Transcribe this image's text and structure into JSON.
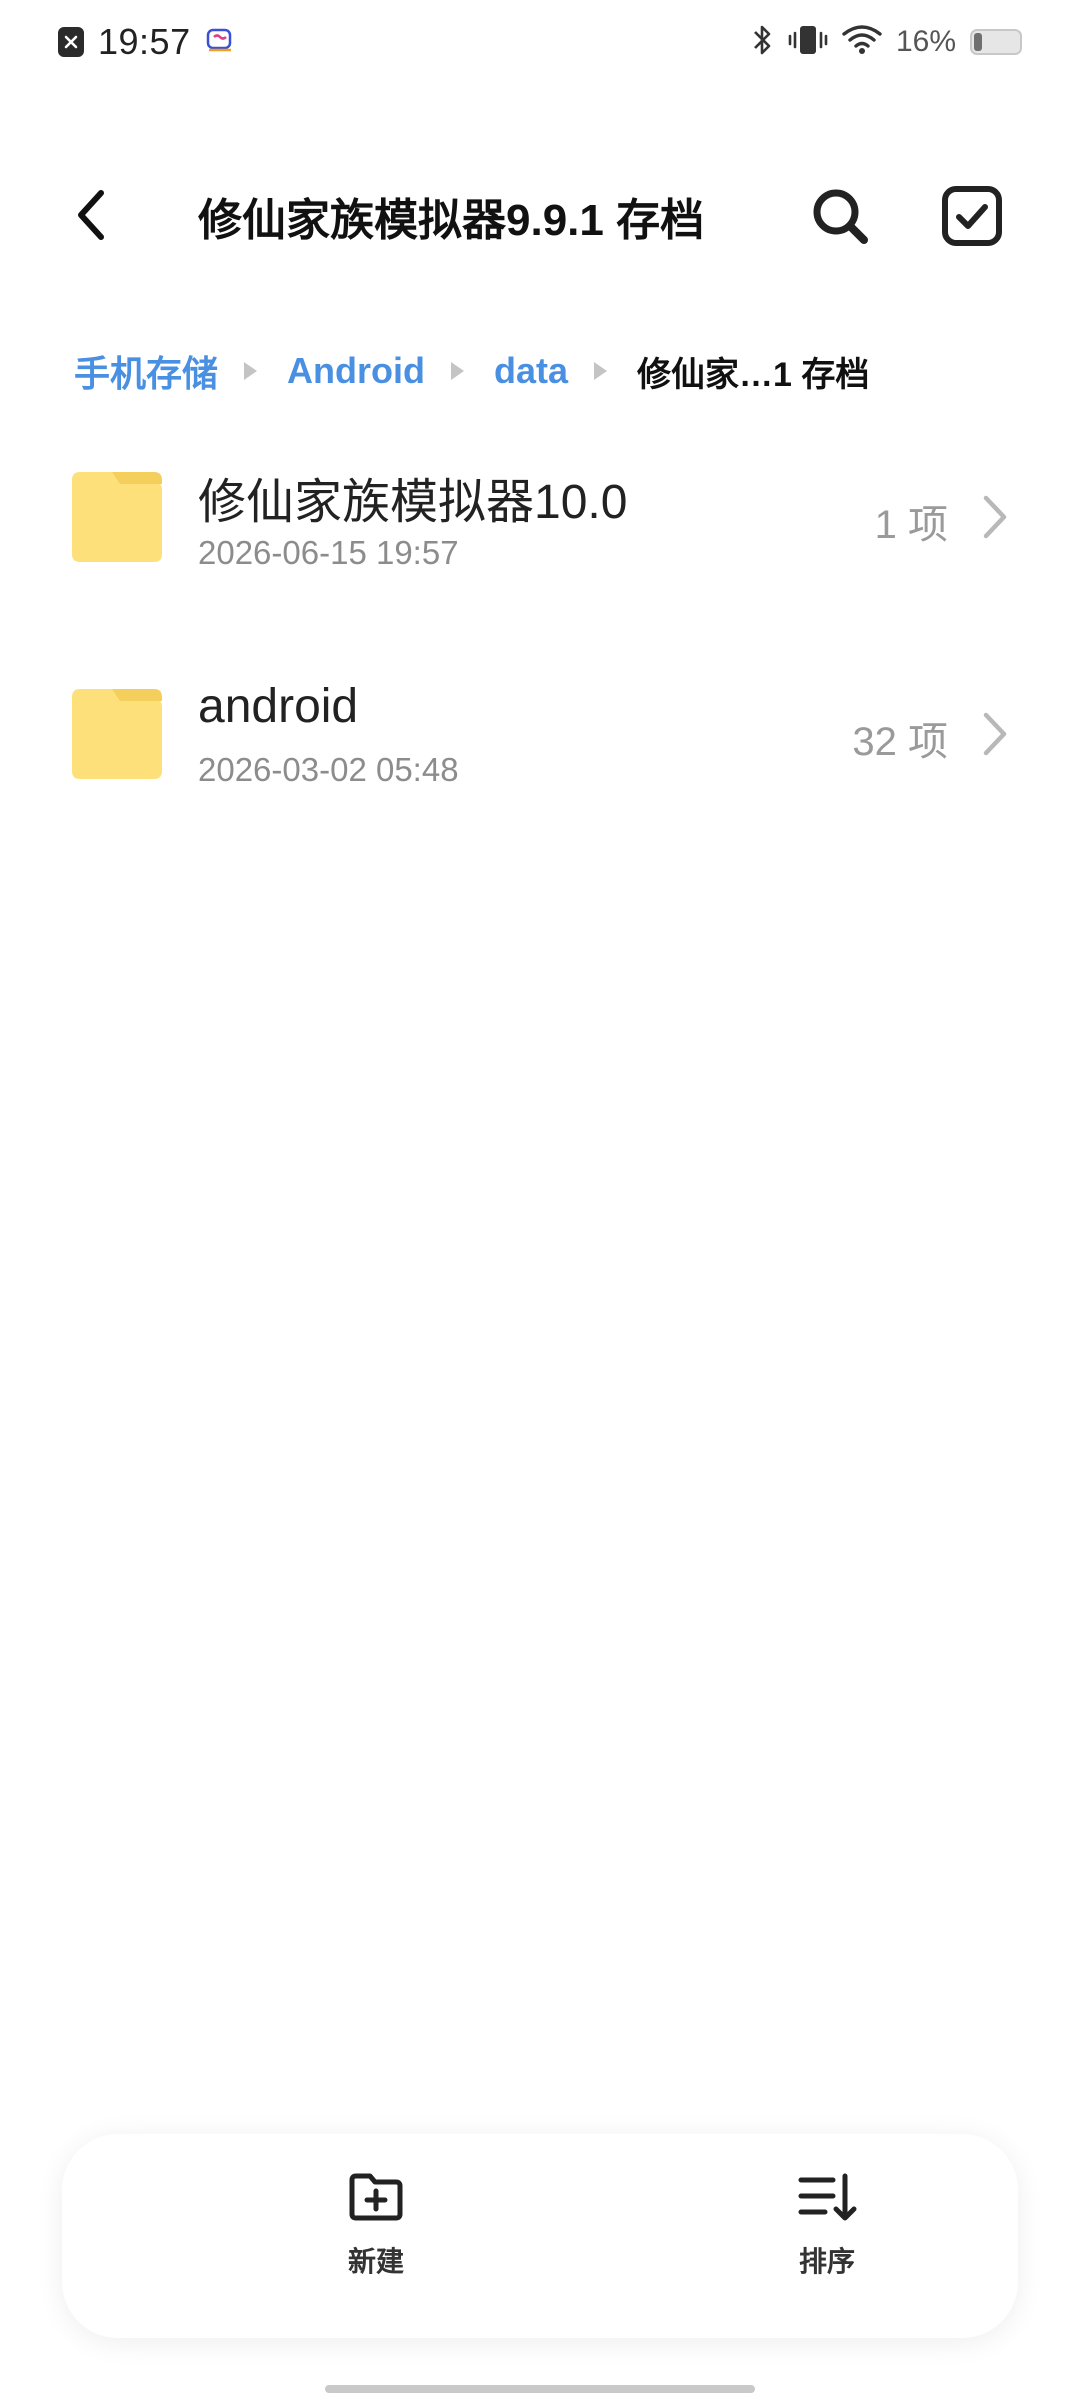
{
  "status_bar": {
    "time": "19:57",
    "battery_percent": "16%",
    "battery_level": 0.16,
    "icons": [
      "notification-close-icon",
      "app-notification-icon",
      "bluetooth-icon",
      "vibrate-icon",
      "wifi-icon",
      "battery-icon"
    ]
  },
  "header": {
    "title": "修仙家族模拟器9.9.1 存档",
    "back_icon": "back-arrow-icon",
    "search_icon": "search-icon",
    "select_icon": "select-checkbox-icon"
  },
  "breadcrumb": {
    "items": [
      "手机存储",
      "Android",
      "data",
      "修仙家…1 存档"
    ]
  },
  "files": [
    {
      "name": "修仙家族模拟器10.0",
      "date": "2026-06-15 19:57",
      "count": "1 项",
      "icon": "folder-icon"
    },
    {
      "name": "android",
      "date": "2026-03-02 05:48",
      "count": "32 项",
      "icon": "folder-icon"
    }
  ],
  "toolbar": {
    "new_label": "新建",
    "sort_label": "排序",
    "new_icon": "new-folder-icon",
    "sort_icon": "sort-icon"
  },
  "colors": {
    "accent": "#4a90e2",
    "folder": "#fde07a",
    "folder_tab": "#f5cf5c"
  }
}
